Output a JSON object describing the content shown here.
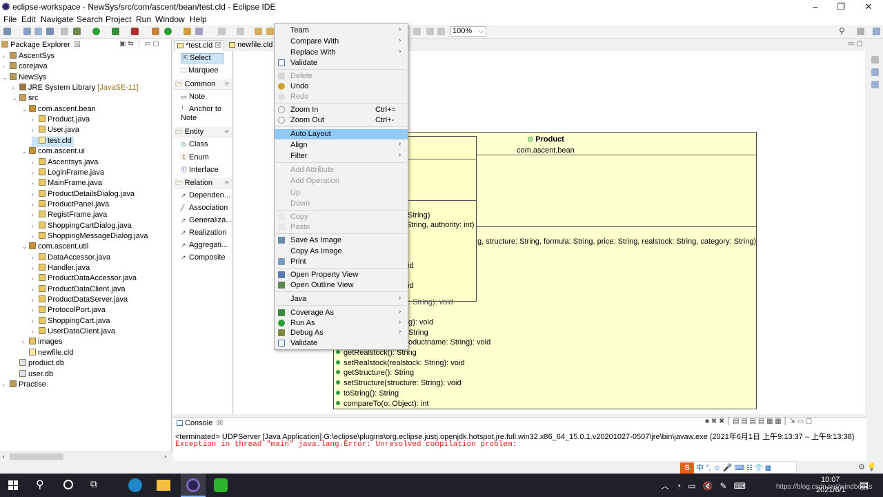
{
  "window": {
    "title": "eclipse-workspace - NewSys/src/com/ascent/bean/test.cld - Eclipse IDE"
  },
  "menubar": [
    "File",
    "Edit",
    "Navigate",
    "Search",
    "Project",
    "Run",
    "Window",
    "Help"
  ],
  "toolbar": {
    "zoom": "100%"
  },
  "package_explorer": {
    "tab_label": "Package Explorer",
    "rows": [
      {
        "label": "AscentSys",
        "indent": 0,
        "tw": ">",
        "kind": "project"
      },
      {
        "label": "corejava",
        "indent": 0,
        "tw": ">",
        "kind": "project"
      },
      {
        "label": "NewSys",
        "indent": 0,
        "tw": "v",
        "kind": "project"
      },
      {
        "label": "JRE System Library",
        "suffix": "[JavaSE-11]",
        "indent": 1,
        "tw": ">",
        "kind": "lib"
      },
      {
        "label": "src",
        "indent": 1,
        "tw": "v",
        "kind": "src"
      },
      {
        "label": "com.ascent.bean",
        "indent": 2,
        "tw": "v",
        "kind": "pkg"
      },
      {
        "label": "Product.java",
        "indent": 3,
        "tw": ">",
        "kind": "java"
      },
      {
        "label": "User.java",
        "indent": 3,
        "tw": ">",
        "kind": "java"
      },
      {
        "label": "test.cld",
        "indent": 3,
        "tw": "",
        "kind": "cld",
        "selected": true
      },
      {
        "label": "com.ascent.ui",
        "indent": 2,
        "tw": "v",
        "kind": "pkg"
      },
      {
        "label": "Ascentsys.java",
        "indent": 3,
        "tw": ">",
        "kind": "java"
      },
      {
        "label": "LoginFrame.java",
        "indent": 3,
        "tw": ">",
        "kind": "java"
      },
      {
        "label": "MainFrame.java",
        "indent": 3,
        "tw": ">",
        "kind": "java"
      },
      {
        "label": "ProductDetailsDialog.java",
        "indent": 3,
        "tw": ">",
        "kind": "java"
      },
      {
        "label": "ProductPanel.java",
        "indent": 3,
        "tw": ">",
        "kind": "java"
      },
      {
        "label": "RegistFrame.java",
        "indent": 3,
        "tw": ">",
        "kind": "java"
      },
      {
        "label": "ShoppingCartDialog.java",
        "indent": 3,
        "tw": ">",
        "kind": "java"
      },
      {
        "label": "ShoppingMessageDialog.java",
        "indent": 3,
        "tw": ">",
        "kind": "java"
      },
      {
        "label": "com.ascent.util",
        "indent": 2,
        "tw": "v",
        "kind": "pkg"
      },
      {
        "label": "DataAccessor.java",
        "indent": 3,
        "tw": ">",
        "kind": "java"
      },
      {
        "label": "Handler.java",
        "indent": 3,
        "tw": ">",
        "kind": "java"
      },
      {
        "label": "ProductDataAccessor.java",
        "indent": 3,
        "tw": ">",
        "kind": "java"
      },
      {
        "label": "ProductDataClient.java",
        "indent": 3,
        "tw": ">",
        "kind": "java"
      },
      {
        "label": "ProductDataServer.java",
        "indent": 3,
        "tw": ">",
        "kind": "java"
      },
      {
        "label": "ProtocolPort.java",
        "indent": 3,
        "tw": ">",
        "kind": "java"
      },
      {
        "label": "ShoppingCart.java",
        "indent": 3,
        "tw": ">",
        "kind": "java"
      },
      {
        "label": "UserDataClient.java",
        "indent": 3,
        "tw": ">",
        "kind": "java"
      },
      {
        "label": "images",
        "indent": 2,
        "tw": ">",
        "kind": "folder"
      },
      {
        "label": "newfile.cld",
        "indent": 2,
        "tw": "",
        "kind": "cld"
      },
      {
        "label": "product.db",
        "indent": 1,
        "tw": "",
        "kind": "file"
      },
      {
        "label": "user.db",
        "indent": 1,
        "tw": "",
        "kind": "file"
      },
      {
        "label": "Practise",
        "indent": 0,
        "tw": ">",
        "kind": "project"
      }
    ]
  },
  "editor_tabs": [
    {
      "label": "*test.cld",
      "active": true
    },
    {
      "label": "newfile.cld",
      "active": false
    }
  ],
  "palette": {
    "select": "Select",
    "marquee": "Marquee",
    "groups": [
      {
        "header": "Common",
        "items": [
          "Note",
          "Anchor to Note"
        ]
      },
      {
        "header": "Entity",
        "items": [
          "Class",
          "Enum",
          "Interface"
        ]
      },
      {
        "header": "Relation",
        "items": [
          "Dependen...",
          "Association",
          "Generaliza...",
          "Realization",
          "Aggregati...",
          "Composite"
        ]
      }
    ]
  },
  "diagram": {
    "class_name": "Product",
    "package": "com.ascent.bean",
    "visible_fragments": [
      "String)",
      "String, authority: int)",
      "g, structure: String, formula: String, price: String, realstock: String, category: String)",
      "id",
      "id",
      ": String): void",
      "g): void",
      "String",
      "oductname: String): void"
    ],
    "methods": [
      "getRealstock(): String",
      "setRealstock(realstock: String): void",
      "getStructure(): String",
      "setStructure(structure: String): void",
      "toString(): String",
      "compareTo(o: Object): int"
    ]
  },
  "context_menu": [
    {
      "label": "Team",
      "submenu": true
    },
    {
      "label": "Compare With",
      "submenu": true
    },
    {
      "label": "Replace With",
      "submenu": true
    },
    {
      "label": "Validate",
      "icon": "check"
    },
    {
      "sep": true
    },
    {
      "label": "Delete",
      "disabled": true,
      "icon": "x"
    },
    {
      "label": "Undo",
      "icon": "undo"
    },
    {
      "label": "Redo",
      "disabled": true,
      "icon": "redo"
    },
    {
      "sep": true
    },
    {
      "label": "Zoom In",
      "accel": "Ctrl+=",
      "icon": "zoom"
    },
    {
      "label": "Zoom Out",
      "accel": "Ctrl+-",
      "icon": "zoom"
    },
    {
      "sep": true
    },
    {
      "label": "Auto Layout",
      "highlighted": true
    },
    {
      "label": "Align",
      "submenu": true
    },
    {
      "label": "Filter",
      "submenu": true
    },
    {
      "sep": true
    },
    {
      "label": "Add Attribute",
      "disabled": true
    },
    {
      "label": "Add Operation",
      "disabled": true
    },
    {
      "label": "Up",
      "disabled": true
    },
    {
      "label": "Down",
      "disabled": true
    },
    {
      "sep": true
    },
    {
      "label": "Copy",
      "disabled": true,
      "icon": "copy"
    },
    {
      "label": "Paste",
      "disabled": true,
      "icon": "paste"
    },
    {
      "sep": true
    },
    {
      "label": "Save As Image",
      "icon": "img"
    },
    {
      "label": "Copy As Image"
    },
    {
      "label": "Print",
      "icon": "print"
    },
    {
      "sep": true
    },
    {
      "label": "Open Property View",
      "icon": "prop"
    },
    {
      "label": "Open Outline View",
      "icon": "outline"
    },
    {
      "sep": true
    },
    {
      "label": "Java",
      "submenu": true
    },
    {
      "sep": true
    },
    {
      "label": "Coverage As",
      "submenu": true,
      "icon": "cov"
    },
    {
      "label": "Run As",
      "submenu": true,
      "icon": "run"
    },
    {
      "label": "Debug As",
      "submenu": true,
      "icon": "debug"
    },
    {
      "label": "Validate",
      "icon": "check"
    }
  ],
  "console": {
    "tab_label": "Console",
    "terminated": "<terminated> UDPServer [Java Application] G:\\eclipse\\plugins\\org.eclipse.justj.openjdk.hotspot.jre.full.win32.x86_64_15.0.1.v20201027-0507\\jre\\bin\\javaw.exe  (2021年6月1日 上午9:13:37 – 上午9:13:38)",
    "error": "Exception in thread \"main\" java.lang.Error: Unresolved compilation problem:"
  },
  "ime": {
    "chars": "中 °, ☺ 🎤"
  },
  "taskbar": {
    "time": "10:07",
    "date": "2021/6/1",
    "watermark": "https://blog.csdn.net/windbooks"
  },
  "colors": {
    "class_fill": "#ffffd0",
    "menu_highlight": "#91c9f7",
    "error_text": "#e02020",
    "method_dot": "#2e9e3a"
  }
}
